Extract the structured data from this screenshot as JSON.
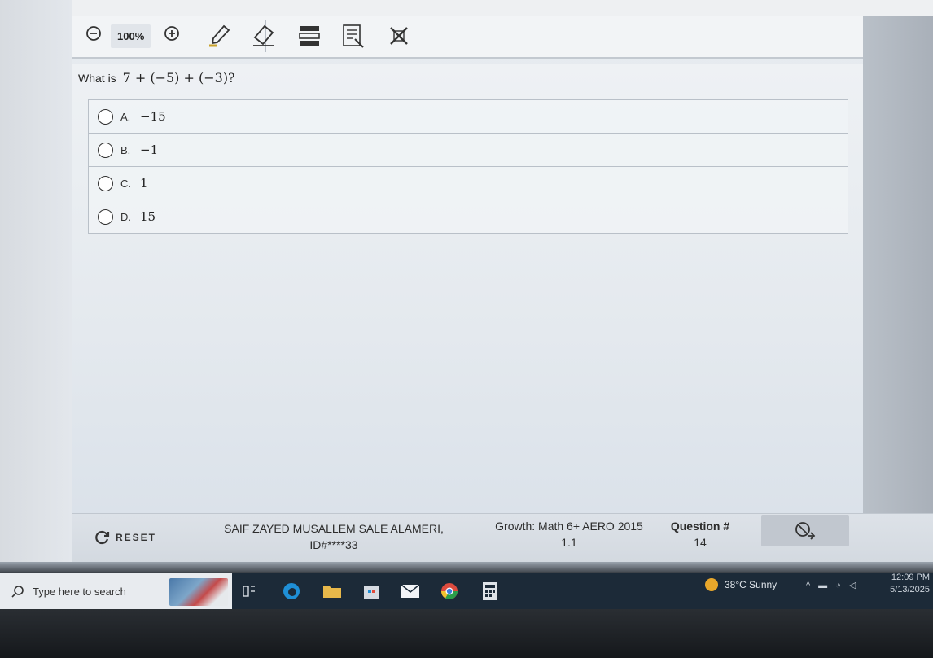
{
  "toolbar": {
    "zoom_level": "100%",
    "zoom_out_icon": "zoom-out-icon",
    "zoom_in_icon": "zoom-in-icon",
    "tools": [
      "highlighter-icon",
      "eraser-icon",
      "line-reader-icon",
      "notepad-icon",
      "answer-eliminator-icon"
    ]
  },
  "question": {
    "prefix": "What is",
    "expression": "7 + (−5) + (−3)?",
    "options": [
      {
        "letter": "A.",
        "value": "−15"
      },
      {
        "letter": "B.",
        "value": "−1"
      },
      {
        "letter": "C.",
        "value": "1"
      },
      {
        "letter": "D.",
        "value": "15"
      }
    ]
  },
  "footer": {
    "reset_label": "RESET",
    "student_name": "SAIF ZAYED MUSALLEM SALE ALAMERI,",
    "student_id": "ID#****33",
    "test_name": "Growth: Math 6+ AERO 2015",
    "test_version": "1.1",
    "question_label": "Question #",
    "question_number": "14"
  },
  "taskbar": {
    "search_placeholder": "Type here to search",
    "weather": "38°C  Sunny",
    "time": "12:09 PM",
    "date": "5/13/2025"
  },
  "colors": {
    "accent_blue": "#2b6fd6",
    "taskbar": "#1c2a38",
    "sun": "#e8a72b"
  }
}
